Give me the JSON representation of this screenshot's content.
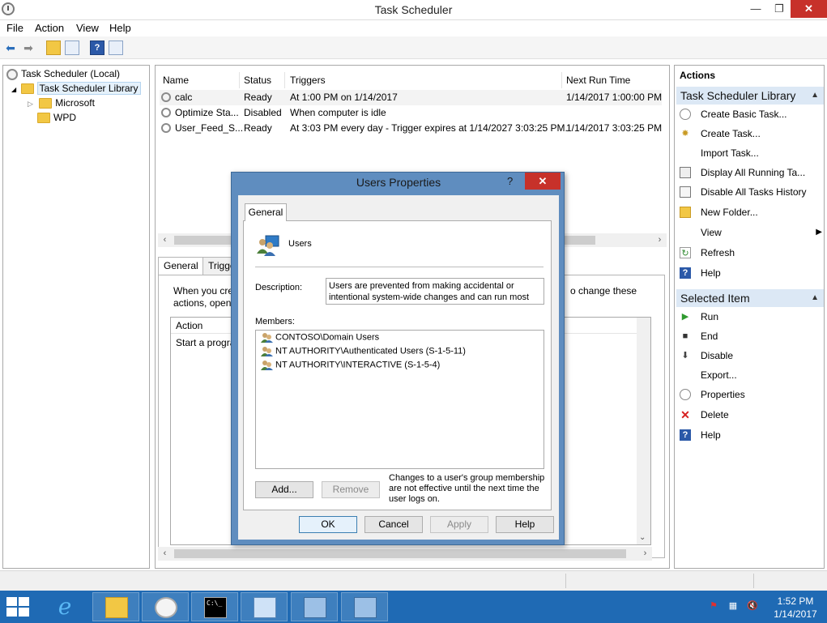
{
  "window": {
    "title": "Task Scheduler",
    "controls": {
      "minimize": "—",
      "maximize": "❐",
      "close": "✕"
    }
  },
  "menu": [
    "File",
    "Action",
    "View",
    "Help"
  ],
  "tree": {
    "root": "Task Scheduler (Local)",
    "library": "Task Scheduler Library",
    "children": [
      "Microsoft",
      "WPD"
    ]
  },
  "tasks": {
    "columns": [
      "Name",
      "Status",
      "Triggers",
      "Next Run Time"
    ],
    "rows": [
      {
        "name": "calc",
        "status": "Ready",
        "trigger": "At 1:00 PM on 1/14/2017",
        "next": "1/14/2017 1:00:00 PM"
      },
      {
        "name": "Optimize Sta...",
        "status": "Disabled",
        "trigger": "When computer is idle",
        "next": ""
      },
      {
        "name": "User_Feed_S...",
        "status": "Ready",
        "trigger": "At 3:03 PM every day - Trigger expires at 1/14/2027 3:03:25 PM.",
        "next": "1/14/2017 3:03:25 PM"
      }
    ]
  },
  "details": {
    "tabs": [
      "General",
      "Trigge"
    ],
    "description_left": "When you cre",
    "description_left2": "actions, open",
    "description_right": "o change these",
    "action_header": "Action",
    "action_row": "Start a progra"
  },
  "actions_pane": {
    "title": "Actions",
    "section1": {
      "header": "Task Scheduler Library",
      "items": [
        "Create Basic Task...",
        "Create Task...",
        "Import Task...",
        "Display All Running Ta...",
        "Disable All Tasks History",
        "New Folder...",
        "View",
        "Refresh",
        "Help"
      ]
    },
    "section2": {
      "header": "Selected Item",
      "items": [
        "Run",
        "End",
        "Disable",
        "Export...",
        "Properties",
        "Delete",
        "Help"
      ]
    }
  },
  "dialog": {
    "title": "Users Properties",
    "help_glyph": "?",
    "close_glyph": "✕",
    "tab": "General",
    "group_name": "Users",
    "description_label": "Description:",
    "description_line1": "Users are prevented from making accidental or",
    "description_line2": "intentional system-wide changes and can run most",
    "members_label": "Members:",
    "members": [
      "CONTOSO\\Domain Users",
      "NT AUTHORITY\\Authenticated Users (S-1-5-11)",
      "NT AUTHORITY\\INTERACTIVE (S-1-5-4)"
    ],
    "add_button": "Add...",
    "remove_button": "Remove",
    "note_line1": "Changes to a user's group membership",
    "note_line2": "are not effective until the next time the",
    "note_line3": "user logs on.",
    "ok": "OK",
    "cancel": "Cancel",
    "apply": "Apply",
    "help": "Help"
  },
  "taskbar": {
    "time": "1:52 PM",
    "date": "1/14/2017",
    "cmd_text": "C:\\_"
  },
  "colors": {
    "taskbar": "#1f6ab4",
    "dialog_frame": "#5f8dbf",
    "close_button": "#c7312a",
    "section_header": "#dce8f5"
  }
}
